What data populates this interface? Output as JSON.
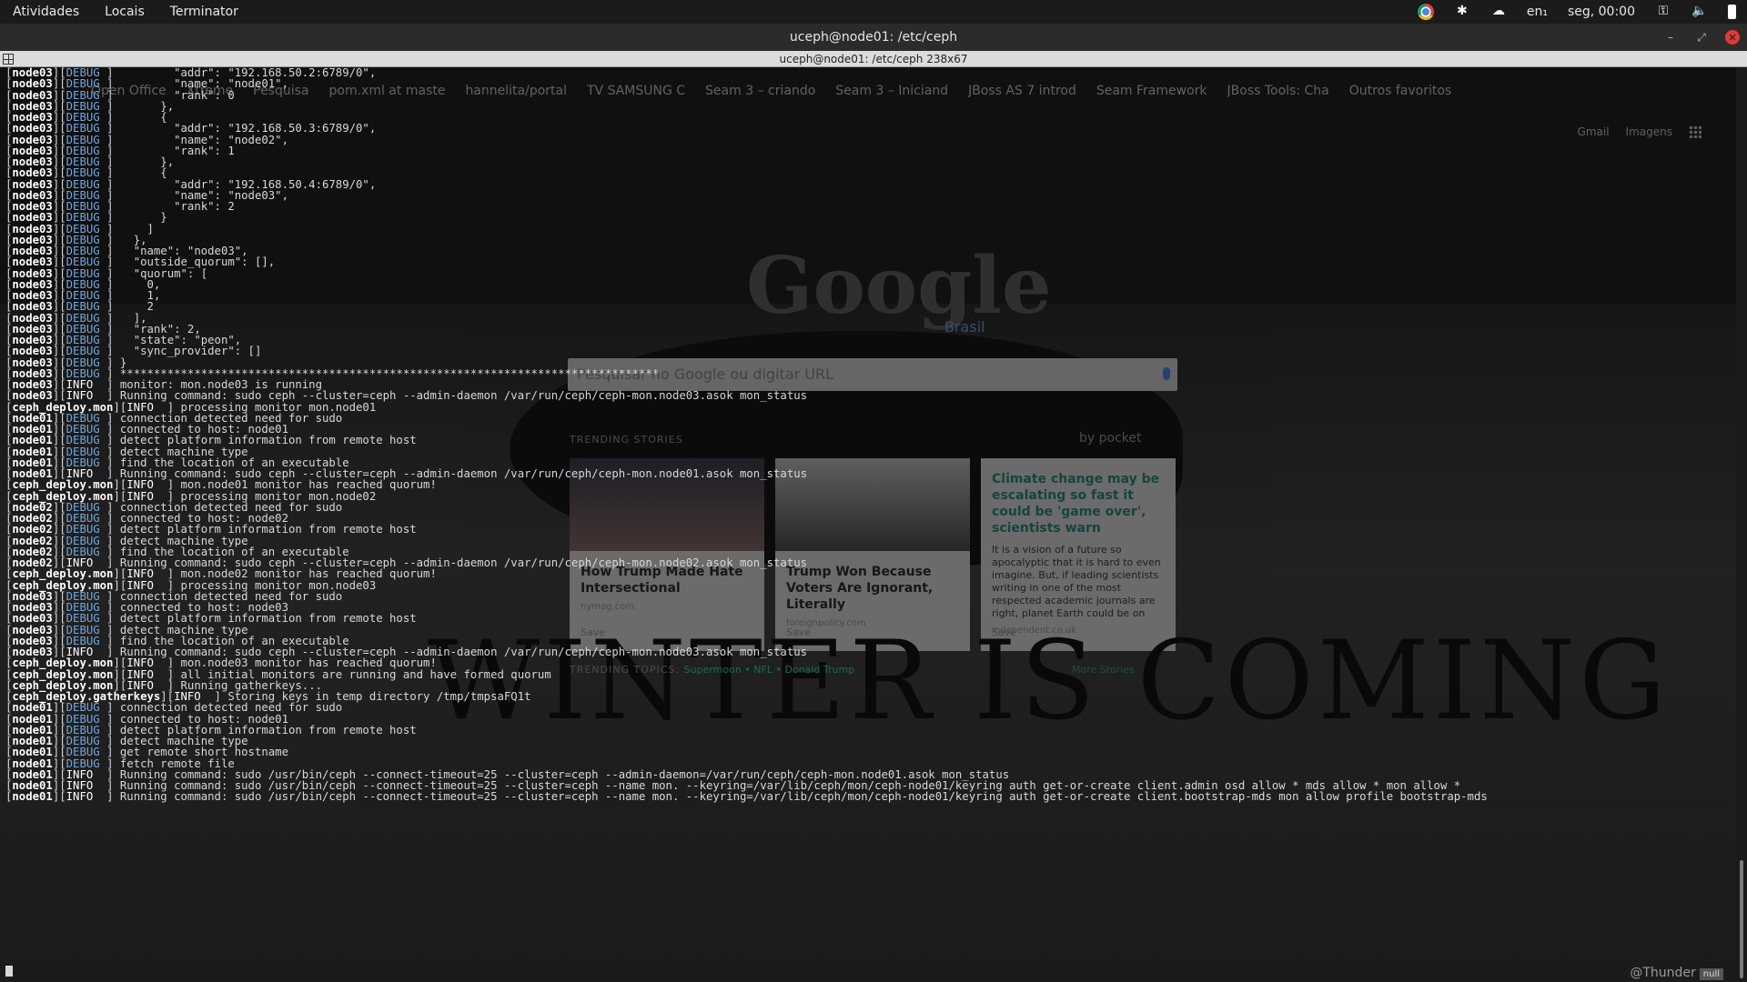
{
  "topbar": {
    "activities": "Atividades",
    "places": "Locais",
    "app": "Terminator",
    "lang": "en₁",
    "clock": "seg, 00:00"
  },
  "window": {
    "title": "uceph@node01: /etc/ceph"
  },
  "tabbar": {
    "title": "uceph@node01: /etc/ceph 238x67"
  },
  "browser_ghost": {
    "bookmarks": [
      "Open Office",
      "Xtreme",
      "Pesquisa",
      "pom.xml at maste",
      "hannelita/portal",
      "TV SAMSUNG C",
      "Seam 3 – criando",
      "Seam 3 – Iniciand",
      "JBoss AS 7 introd",
      "Seam Framework",
      "JBoss Tools: Cha",
      "Outros favoritos"
    ],
    "links": [
      "Gmail",
      "Imagens"
    ],
    "logo": "Google",
    "region": "Brasil",
    "search_placeholder": "Pesquisar no Google ou digitar URL",
    "trending_label": "TRENDING STORIES",
    "pocket_label": "by pocket",
    "cards": [
      {
        "title": "How Trump Made Hate Intersectional",
        "source": "nymag.com",
        "save": "Save"
      },
      {
        "title": "Trump Won Because Voters Are Ignorant, Literally",
        "source": "foreignpolicy.com",
        "save": "Save"
      },
      {
        "title": "Climate change may be escalating so fast it could be 'game over', scientists warn",
        "excerpt": "It is a vision of a future so apocalyptic that it is hard to even imagine. But, if leading scientists writing in one of the most respected academic journals are right, planet Earth could be on",
        "source": "independent.co.uk",
        "save": "Save"
      }
    ],
    "topics_label": "TRENDING TOPICS:",
    "topics": "Supermoon • NFL • Donald Trump",
    "more": "More Stories",
    "wallpaper_text": "WINTER IS COMING"
  },
  "terminal": {
    "lines": [
      {
        "h": "node03",
        "l": "DEBUG",
        "t": "        \"addr\": \"192.168.50.2:6789/0\","
      },
      {
        "h": "node03",
        "l": "DEBUG",
        "t": "        \"name\": \"node01\","
      },
      {
        "h": "node03",
        "l": "DEBUG",
        "t": "        \"rank\": 0"
      },
      {
        "h": "node03",
        "l": "DEBUG",
        "t": "      },"
      },
      {
        "h": "node03",
        "l": "DEBUG",
        "t": "      {"
      },
      {
        "h": "node03",
        "l": "DEBUG",
        "t": "        \"addr\": \"192.168.50.3:6789/0\","
      },
      {
        "h": "node03",
        "l": "DEBUG",
        "t": "        \"name\": \"node02\","
      },
      {
        "h": "node03",
        "l": "DEBUG",
        "t": "        \"rank\": 1"
      },
      {
        "h": "node03",
        "l": "DEBUG",
        "t": "      },"
      },
      {
        "h": "node03",
        "l": "DEBUG",
        "t": "      {"
      },
      {
        "h": "node03",
        "l": "DEBUG",
        "t": "        \"addr\": \"192.168.50.4:6789/0\","
      },
      {
        "h": "node03",
        "l": "DEBUG",
        "t": "        \"name\": \"node03\","
      },
      {
        "h": "node03",
        "l": "DEBUG",
        "t": "        \"rank\": 2"
      },
      {
        "h": "node03",
        "l": "DEBUG",
        "t": "      }"
      },
      {
        "h": "node03",
        "l": "DEBUG",
        "t": "    ]"
      },
      {
        "h": "node03",
        "l": "DEBUG",
        "t": "  },"
      },
      {
        "h": "node03",
        "l": "DEBUG",
        "t": "  \"name\": \"node03\","
      },
      {
        "h": "node03",
        "l": "DEBUG",
        "t": "  \"outside_quorum\": [],"
      },
      {
        "h": "node03",
        "l": "DEBUG",
        "t": "  \"quorum\": ["
      },
      {
        "h": "node03",
        "l": "DEBUG",
        "t": "    0,"
      },
      {
        "h": "node03",
        "l": "DEBUG",
        "t": "    1,"
      },
      {
        "h": "node03",
        "l": "DEBUG",
        "t": "    2"
      },
      {
        "h": "node03",
        "l": "DEBUG",
        "t": "  ],"
      },
      {
        "h": "node03",
        "l": "DEBUG",
        "t": "  \"rank\": 2,"
      },
      {
        "h": "node03",
        "l": "DEBUG",
        "t": "  \"state\": \"peon\","
      },
      {
        "h": "node03",
        "l": "DEBUG",
        "t": "  \"sync_provider\": []"
      },
      {
        "h": "node03",
        "l": "DEBUG",
        "t": "}"
      },
      {
        "h": "node03",
        "l": "DEBUG",
        "t": "********************************************************************************"
      },
      {
        "h": "node03",
        "l": "INFO",
        "t": "monitor: mon.node03 is running"
      },
      {
        "h": "node03",
        "l": "INFO",
        "t": "Running command: sudo ceph --cluster=ceph --admin-daemon /var/run/ceph/ceph-mon.node03.asok mon_status"
      },
      {
        "h": "ceph_deploy.mon",
        "l": "INFO",
        "t": "processing monitor mon.node01"
      },
      {
        "h": "node01",
        "l": "DEBUG",
        "t": "connection detected need for sudo"
      },
      {
        "h": "node01",
        "l": "DEBUG",
        "t": "connected to host: node01"
      },
      {
        "h": "node01",
        "l": "DEBUG",
        "t": "detect platform information from remote host"
      },
      {
        "h": "node01",
        "l": "DEBUG",
        "t": "detect machine type"
      },
      {
        "h": "node01",
        "l": "DEBUG",
        "t": "find the location of an executable"
      },
      {
        "h": "node01",
        "l": "INFO",
        "t": "Running command: sudo ceph --cluster=ceph --admin-daemon /var/run/ceph/ceph-mon.node01.asok mon_status"
      },
      {
        "h": "ceph_deploy.mon",
        "l": "INFO",
        "t": "mon.node01 monitor has reached quorum!"
      },
      {
        "h": "ceph_deploy.mon",
        "l": "INFO",
        "t": "processing monitor mon.node02"
      },
      {
        "h": "node02",
        "l": "DEBUG",
        "t": "connection detected need for sudo"
      },
      {
        "h": "node02",
        "l": "DEBUG",
        "t": "connected to host: node02"
      },
      {
        "h": "node02",
        "l": "DEBUG",
        "t": "detect platform information from remote host"
      },
      {
        "h": "node02",
        "l": "DEBUG",
        "t": "detect machine type"
      },
      {
        "h": "node02",
        "l": "DEBUG",
        "t": "find the location of an executable"
      },
      {
        "h": "node02",
        "l": "INFO",
        "t": "Running command: sudo ceph --cluster=ceph --admin-daemon /var/run/ceph/ceph-mon.node02.asok mon_status"
      },
      {
        "h": "ceph_deploy.mon",
        "l": "INFO",
        "t": "mon.node02 monitor has reached quorum!"
      },
      {
        "h": "ceph_deploy.mon",
        "l": "INFO",
        "t": "processing monitor mon.node03"
      },
      {
        "h": "node03",
        "l": "DEBUG",
        "t": "connection detected need for sudo"
      },
      {
        "h": "node03",
        "l": "DEBUG",
        "t": "connected to host: node03"
      },
      {
        "h": "node03",
        "l": "DEBUG",
        "t": "detect platform information from remote host"
      },
      {
        "h": "node03",
        "l": "DEBUG",
        "t": "detect machine type"
      },
      {
        "h": "node03",
        "l": "DEBUG",
        "t": "find the location of an executable"
      },
      {
        "h": "node03",
        "l": "INFO",
        "t": "Running command: sudo ceph --cluster=ceph --admin-daemon /var/run/ceph/ceph-mon.node03.asok mon_status"
      },
      {
        "h": "ceph_deploy.mon",
        "l": "INFO",
        "t": "mon.node03 monitor has reached quorum!"
      },
      {
        "h": "ceph_deploy.mon",
        "l": "INFO",
        "t": "all initial monitors are running and have formed quorum"
      },
      {
        "h": "ceph_deploy.mon",
        "l": "INFO",
        "t": "Running gatherkeys..."
      },
      {
        "h": "ceph_deploy.gatherkeys",
        "l": "INFO",
        "t": "Storing keys in temp directory /tmp/tmpsaFQ1t"
      },
      {
        "h": "node01",
        "l": "DEBUG",
        "t": "connection detected need for sudo"
      },
      {
        "h": "node01",
        "l": "DEBUG",
        "t": "connected to host: node01"
      },
      {
        "h": "node01",
        "l": "DEBUG",
        "t": "detect platform information from remote host"
      },
      {
        "h": "node01",
        "l": "DEBUG",
        "t": "detect machine type"
      },
      {
        "h": "node01",
        "l": "DEBUG",
        "t": "get remote short hostname"
      },
      {
        "h": "node01",
        "l": "DEBUG",
        "t": "fetch remote file"
      },
      {
        "h": "node01",
        "l": "INFO",
        "t": "Running command: sudo /usr/bin/ceph --connect-timeout=25 --cluster=ceph --admin-daemon=/var/run/ceph/ceph-mon.node01.asok mon_status"
      },
      {
        "h": "node01",
        "l": "INFO",
        "t": "Running command: sudo /usr/bin/ceph --connect-timeout=25 --cluster=ceph --name mon. --keyring=/var/lib/ceph/mon/ceph-node01/keyring auth get-or-create client.admin osd allow * mds allow * mon allow *"
      },
      {
        "h": "node01",
        "l": "INFO",
        "t": "Running command: sudo /usr/bin/ceph --connect-timeout=25 --cluster=ceph --name mon. --keyring=/var/lib/ceph/mon/ceph-node01/keyring auth get-or-create client.bootstrap-mds mon allow profile bootstrap-mds"
      }
    ]
  },
  "watermark": {
    "name": "@Thunder",
    "tag": "null"
  }
}
